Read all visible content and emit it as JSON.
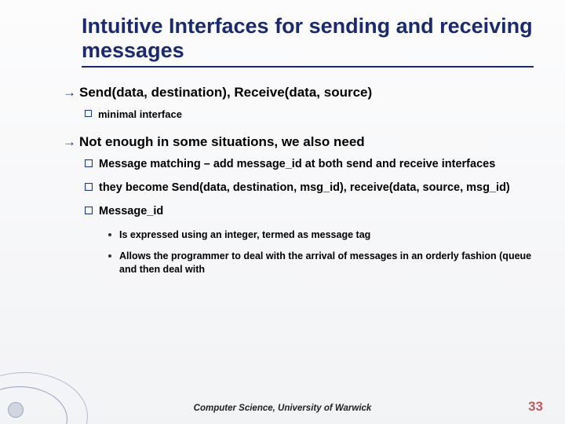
{
  "title": "Intuitive Interfaces for sending and receiving messages",
  "bullets": {
    "l1_a": "Send(data, destination), Receive(data, source)",
    "l2_a": "minimal interface",
    "l1_b": "Not enough in some situations, we also need",
    "l2_b": "Message matching – add message_id at both send and receive interfaces",
    "l2_c": "they become Send(data, destination, msg_id), receive(data, source, msg_id)",
    "l2_d": "Message_id",
    "l3_a": "Is expressed using an integer, termed as message tag",
    "l3_b": "Allows the programmer to deal with the arrival of messages in an orderly fashion (queue and then deal with"
  },
  "footer": "Computer Science, University of Warwick",
  "page_number": "33"
}
